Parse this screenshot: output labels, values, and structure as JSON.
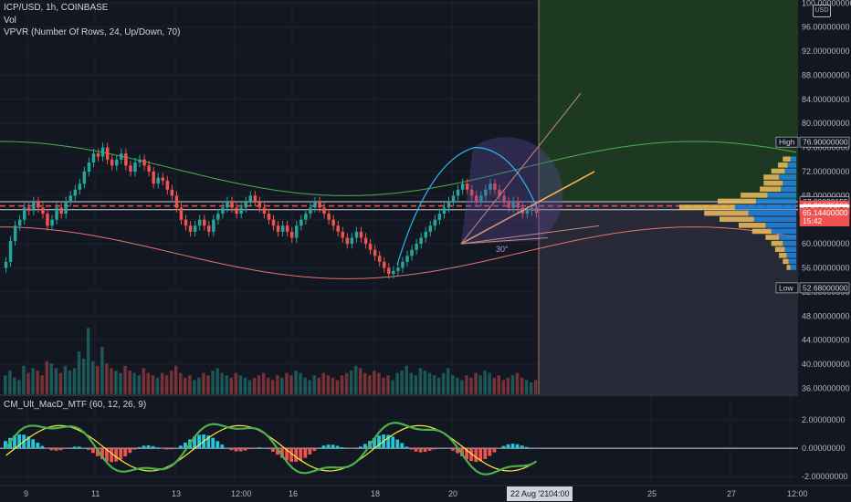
{
  "header": {
    "symbol_line": "ICP/USD, 1h, COINBASE",
    "volume_label": "Vol",
    "vpvr_label": "VPVR (Number Of Rows, 24, Up/Down, 70)",
    "currency_badge": "USD"
  },
  "macd_panel": {
    "label": "CM_Ult_MacD_MTF (60, 12, 26, 9)"
  },
  "colors": {
    "background": "#131722",
    "up": "#26a69a",
    "down": "#ef5350",
    "vpvr_up": "#f0c05a",
    "vpvr_down": "#1e88e5",
    "target_zone": "#1e3b23",
    "stop_zone": "#2b2b3a"
  },
  "chart_data": {
    "type": "candlestick",
    "symbol": "ICP/USD",
    "timeframe": "1h",
    "exchange": "COINBASE",
    "price_axis": {
      "ticks": [
        "100.00000000",
        "96.00000000",
        "92.00000000",
        "88.00000000",
        "84.00000000",
        "80.00000000",
        "76.00000000",
        "72.00000000",
        "68.00000000",
        "64.00000000",
        "60.00000000",
        "56.00000000",
        "52.00000000",
        "48.00000000",
        "44.00000000",
        "40.00000000",
        "36.00000000"
      ],
      "tick_values": [
        100,
        96,
        92,
        88,
        84,
        80,
        76,
        72,
        68,
        64,
        60,
        56,
        52,
        48,
        44,
        40,
        36
      ],
      "ylim": [
        35,
        100.5
      ]
    },
    "price_labels": [
      {
        "name": "High",
        "text": "76.90000000",
        "value": 76.9,
        "tag": "High"
      },
      {
        "name": "level",
        "text": "67.00089155",
        "value": 67.0,
        "tag": ""
      },
      {
        "name": "red-level",
        "text": "66.30075000",
        "value": 66.3,
        "tag": ""
      },
      {
        "name": "level2",
        "text": "65.65983470",
        "value": 65.66,
        "tag": ""
      },
      {
        "name": "last",
        "text": "65.14400000",
        "value": 65.14,
        "tag": "",
        "sub": "15:42"
      },
      {
        "name": "Low",
        "text": "52.68000000",
        "value": 52.68,
        "tag": "Low"
      }
    ],
    "time_axis": {
      "ticks": [
        "9",
        "11",
        "13",
        "12:00",
        "16",
        "18",
        "20",
        "25",
        "27",
        "12:00"
      ],
      "cursor_label": "22 Aug '21",
      "cursor_time": "04:00"
    },
    "closes": [
      57,
      60.5,
      63,
      64,
      66,
      65.5,
      67,
      66,
      65,
      63,
      64,
      66,
      65,
      67,
      68,
      69,
      70,
      72,
      73.5,
      75,
      74.5,
      76,
      74,
      73,
      74,
      75,
      73,
      72,
      73.5,
      74,
      73,
      72,
      70,
      71,
      70.5,
      69,
      68,
      66,
      64,
      63,
      62,
      63,
      64,
      63,
      62,
      64,
      65,
      66,
      67,
      66,
      65,
      66,
      67,
      68,
      67,
      66,
      65,
      64,
      63,
      62,
      63,
      62,
      61,
      63,
      64,
      65,
      66,
      67,
      66,
      65,
      64,
      63,
      62,
      61,
      60,
      61,
      62,
      61,
      60,
      59,
      58,
      57,
      56,
      55,
      55.5,
      56,
      57,
      58,
      59,
      60,
      61,
      62,
      63,
      64,
      65,
      66,
      67,
      68,
      69,
      70,
      69,
      68,
      67,
      68,
      69,
      70,
      69,
      68,
      67,
      66,
      67,
      66,
      65,
      65.5,
      66,
      65.14
    ],
    "volumes": [
      8,
      10,
      7,
      6,
      12,
      9,
      11,
      10,
      8,
      14,
      13,
      11,
      9,
      12,
      10,
      11,
      18,
      15,
      28,
      14,
      12,
      20,
      13,
      11,
      10,
      9,
      12,
      10,
      9,
      8,
      11,
      9,
      8,
      7,
      9,
      8,
      10,
      12,
      9,
      7,
      8,
      6,
      7,
      9,
      8,
      10,
      11,
      9,
      8,
      7,
      9,
      8,
      7,
      6,
      7,
      8,
      9,
      7,
      6,
      8,
      7,
      9,
      8,
      10,
      9,
      7,
      6,
      8,
      7,
      9,
      8,
      7,
      6,
      8,
      9,
      10,
      12,
      11,
      9,
      8,
      10,
      9,
      7,
      8,
      6,
      9,
      10,
      12,
      9,
      8,
      11,
      10,
      9,
      8,
      7,
      9,
      11,
      8,
      7,
      6,
      8,
      7,
      9,
      8,
      10,
      9,
      7,
      8,
      6,
      7,
      8,
      9,
      7,
      6,
      5,
      6
    ],
    "macd": {
      "ticks": [
        "2.00000000",
        "0.00000000",
        "-2.00000000"
      ],
      "tick_values": [
        2,
        0,
        -2
      ],
      "ylim": [
        -2.5,
        2.9
      ]
    },
    "vpvr_rows": [
      {
        "price": 74,
        "up": 8,
        "down": 6
      },
      {
        "price": 73,
        "up": 10,
        "down": 9
      },
      {
        "price": 72,
        "up": 14,
        "down": 12
      },
      {
        "price": 71,
        "up": 16,
        "down": 18
      },
      {
        "price": 70,
        "up": 20,
        "down": 14
      },
      {
        "price": 69,
        "up": 22,
        "down": 16
      },
      {
        "price": 68,
        "up": 28,
        "down": 30
      },
      {
        "price": 67,
        "up": 40,
        "down": 42
      },
      {
        "price": 66,
        "up": 58,
        "down": 64
      },
      {
        "price": 65,
        "up": 46,
        "down": 50
      },
      {
        "price": 64,
        "up": 36,
        "down": 44
      },
      {
        "price": 63,
        "up": 28,
        "down": 32
      },
      {
        "price": 62,
        "up": 20,
        "down": 26
      },
      {
        "price": 61,
        "up": 14,
        "down": 18
      },
      {
        "price": 60,
        "up": 12,
        "down": 14
      },
      {
        "price": 59,
        "up": 10,
        "down": 12
      },
      {
        "price": 58,
        "up": 8,
        "down": 10
      },
      {
        "price": 57,
        "up": 6,
        "down": 8
      },
      {
        "price": 56,
        "up": 4,
        "down": 6
      }
    ],
    "annotations": {
      "fib_fan_label": "30°"
    }
  }
}
